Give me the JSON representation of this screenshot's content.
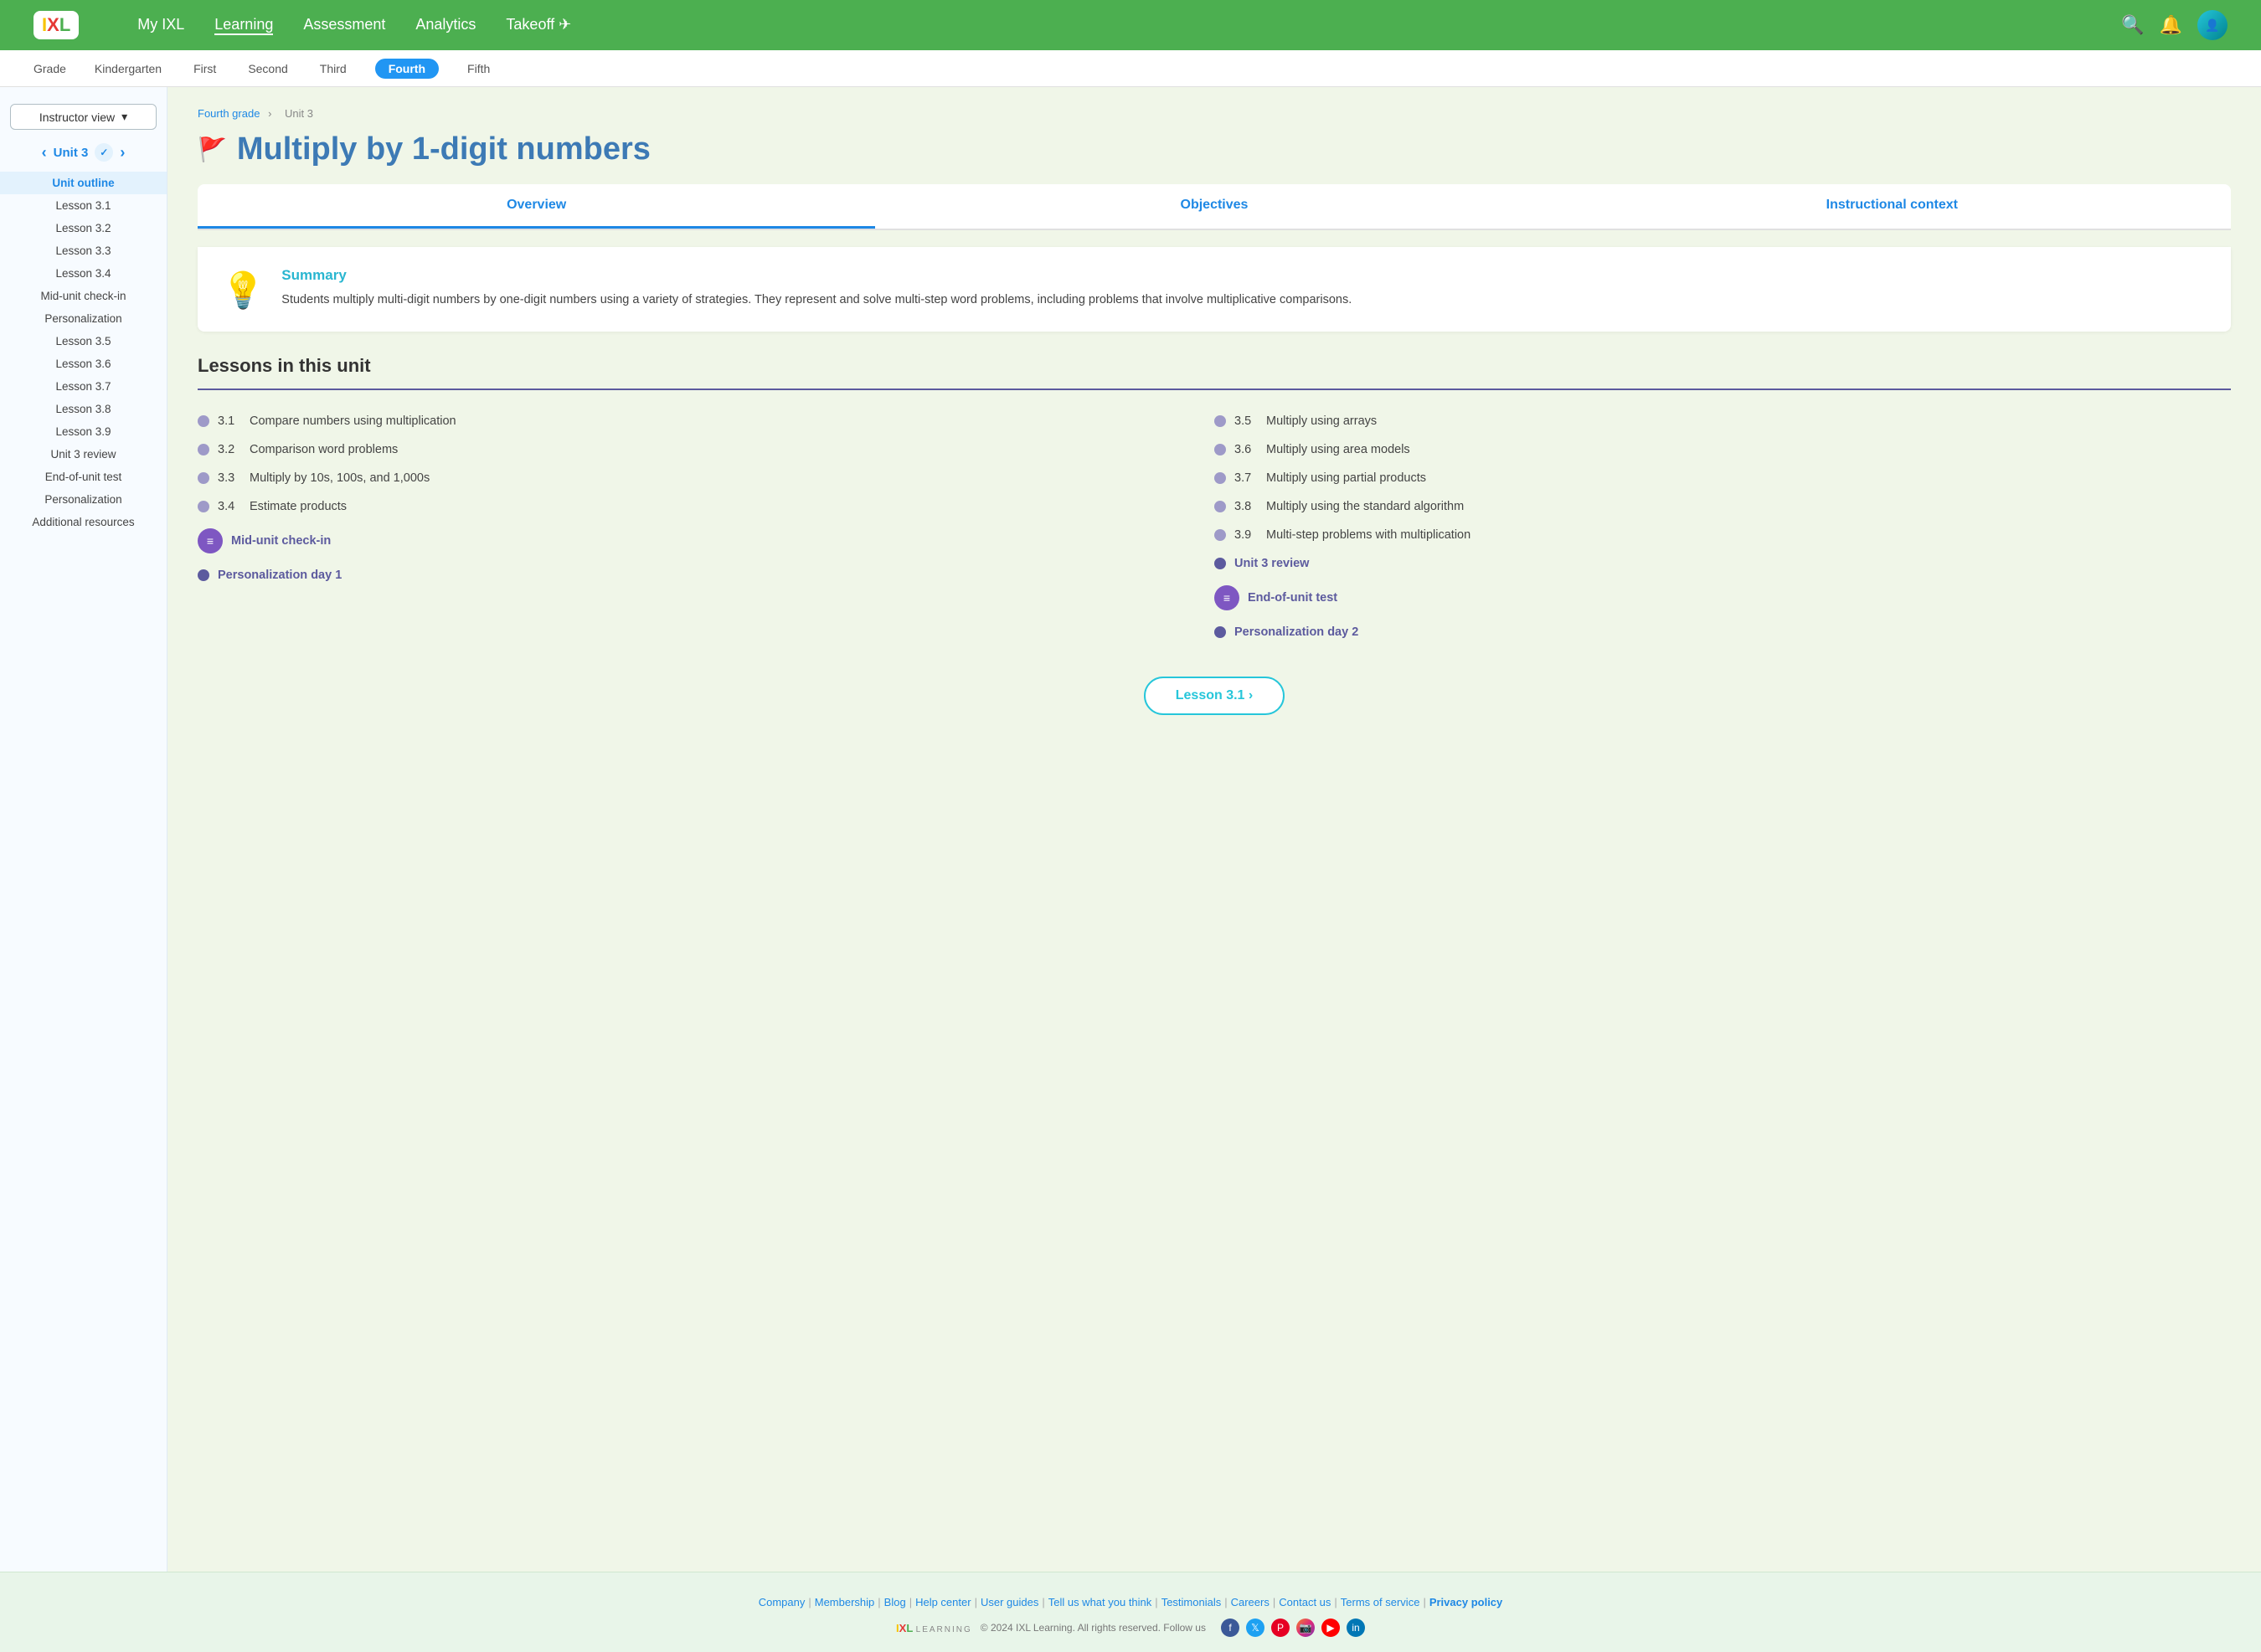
{
  "nav": {
    "links": [
      "My IXL",
      "Learning",
      "Assessment",
      "Analytics",
      "Takeoff"
    ],
    "active": "Learning"
  },
  "grade_bar": {
    "label": "Grade",
    "grades": [
      "Kindergarten",
      "First",
      "Second",
      "Third",
      "Fourth",
      "Fifth"
    ],
    "active": "Fourth"
  },
  "sidebar": {
    "instructor_view": "Instructor view",
    "unit_label": "Unit 3",
    "items": [
      {
        "label": "Unit outline",
        "active": true
      },
      {
        "label": "Lesson 3.1",
        "active": false
      },
      {
        "label": "Lesson 3.2",
        "active": false
      },
      {
        "label": "Lesson 3.3",
        "active": false
      },
      {
        "label": "Lesson 3.4",
        "active": false
      },
      {
        "label": "Mid-unit check-in",
        "active": false
      },
      {
        "label": "Personalization",
        "active": false
      },
      {
        "label": "Lesson 3.5",
        "active": false
      },
      {
        "label": "Lesson 3.6",
        "active": false
      },
      {
        "label": "Lesson 3.7",
        "active": false
      },
      {
        "label": "Lesson 3.8",
        "active": false
      },
      {
        "label": "Lesson 3.9",
        "active": false
      },
      {
        "label": "Unit 3 review",
        "active": false
      },
      {
        "label": "End-of-unit test",
        "active": false
      },
      {
        "label": "Personalization",
        "active": false
      },
      {
        "label": "Additional resources",
        "active": false
      }
    ]
  },
  "breadcrumb": {
    "parent": "Fourth grade",
    "child": "Unit 3"
  },
  "page": {
    "title": "Multiply by 1-digit numbers",
    "tabs": [
      "Overview",
      "Objectives",
      "Instructional context"
    ],
    "active_tab": "Overview"
  },
  "summary": {
    "heading": "Summary",
    "text": "Students multiply multi-digit numbers by one-digit numbers using a variety of strategies. They represent and solve multi-step word problems, including problems that involve multiplicative comparisons."
  },
  "lessons": {
    "section_title": "Lessons in this unit",
    "left": [
      {
        "num": "3.1",
        "name": "Compare numbers using multiplication",
        "type": "normal"
      },
      {
        "num": "3.2",
        "name": "Comparison word problems",
        "type": "normal"
      },
      {
        "num": "3.3",
        "name": "Multiply by 10s, 100s, and 1,000s",
        "type": "normal"
      },
      {
        "num": "3.4",
        "name": "Estimate products",
        "type": "normal"
      },
      {
        "num": "",
        "name": "Mid-unit check-in",
        "type": "special"
      },
      {
        "num": "",
        "name": "Personalization day 1",
        "type": "bold"
      }
    ],
    "right": [
      {
        "num": "3.5",
        "name": "Multiply using arrays",
        "type": "normal"
      },
      {
        "num": "3.6",
        "name": "Multiply using area models",
        "type": "normal"
      },
      {
        "num": "3.7",
        "name": "Multiply using partial products",
        "type": "normal"
      },
      {
        "num": "3.8",
        "name": "Multiply using the standard algorithm",
        "type": "normal"
      },
      {
        "num": "3.9",
        "name": "Multi-step problems with multiplication",
        "type": "normal"
      },
      {
        "num": "",
        "name": "Unit 3 review",
        "type": "bold"
      },
      {
        "num": "",
        "name": "End-of-unit test",
        "type": "special"
      },
      {
        "num": "",
        "name": "Personalization day 2",
        "type": "bold"
      }
    ]
  },
  "next_button": "Lesson 3.1 ›",
  "footer": {
    "links": [
      "Company",
      "Membership",
      "Blog",
      "Help center",
      "User guides",
      "Tell us what you think",
      "Testimonials",
      "Careers",
      "Contact us",
      "Terms of service",
      "Privacy policy"
    ],
    "copyright": "© 2024 IXL Learning. All rights reserved. Follow us",
    "bold_link": "Privacy policy"
  }
}
